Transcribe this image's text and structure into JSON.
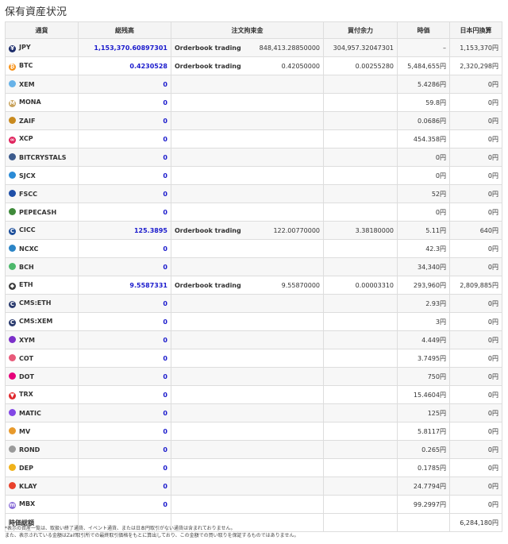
{
  "title": "保有資産状況",
  "headers": [
    "通貨",
    "総残高",
    "注文拘束金",
    "買付余力",
    "時価",
    "日本円換算"
  ],
  "rows": [
    {
      "currency": "JPY",
      "icon": "yen-icon",
      "icon_color": "#1d2d6b",
      "glyph": "¥",
      "balance": "1,153,370.60897301",
      "order_type": "Orderbook trading",
      "order_amount": "848,413.28850000",
      "buying_power": "304,957.32047301",
      "price": "–",
      "jpy_value": "1,153,370円"
    },
    {
      "currency": "BTC",
      "icon": "btc-icon",
      "icon_color": "#f7931a",
      "glyph": "₿",
      "balance": "0.4230528",
      "order_type": "Orderbook trading",
      "order_amount": "0.42050000",
      "buying_power": "0.00255280",
      "price": "5,484,655円",
      "jpy_value": "2,320,298円"
    },
    {
      "currency": "XEM",
      "icon": "xem-icon",
      "icon_color": "#67b2e8",
      "glyph": "",
      "balance": "0",
      "order_type": "",
      "order_amount": "",
      "buying_power": "",
      "price": "5.4286円",
      "jpy_value": "0円"
    },
    {
      "currency": "MONA",
      "icon": "mona-icon",
      "icon_color": "#c8a25b",
      "glyph": "M",
      "balance": "0",
      "order_type": "",
      "order_amount": "",
      "buying_power": "",
      "price": "59.8円",
      "jpy_value": "0円"
    },
    {
      "currency": "ZAIF",
      "icon": "zaif-icon",
      "icon_color": "#c98a1e",
      "glyph": "",
      "balance": "0",
      "order_type": "",
      "order_amount": "",
      "buying_power": "",
      "price": "0.0686円",
      "jpy_value": "0円"
    },
    {
      "currency": "XCP",
      "icon": "xcp-icon",
      "icon_color": "#e0245e",
      "glyph": "∞",
      "balance": "0",
      "order_type": "",
      "order_amount": "",
      "buying_power": "",
      "price": "454.358円",
      "jpy_value": "0円"
    },
    {
      "currency": "BITCRYSTALS",
      "icon": "bitcrystals-icon",
      "icon_color": "#3b5a8c",
      "glyph": "",
      "balance": "0",
      "order_type": "",
      "order_amount": "",
      "buying_power": "",
      "price": "0円",
      "jpy_value": "0円"
    },
    {
      "currency": "SJCX",
      "icon": "sjcx-icon",
      "icon_color": "#2a8bd6",
      "glyph": "",
      "balance": "0",
      "order_type": "",
      "order_amount": "",
      "buying_power": "",
      "price": "0円",
      "jpy_value": "0円"
    },
    {
      "currency": "FSCC",
      "icon": "fscc-icon",
      "icon_color": "#1f4fa8",
      "glyph": "",
      "balance": "0",
      "order_type": "",
      "order_amount": "",
      "buying_power": "",
      "price": "52円",
      "jpy_value": "0円"
    },
    {
      "currency": "PEPECASH",
      "icon": "pepecash-icon",
      "icon_color": "#3f8a3a",
      "glyph": "",
      "balance": "0",
      "order_type": "",
      "order_amount": "",
      "buying_power": "",
      "price": "0円",
      "jpy_value": "0円"
    },
    {
      "currency": "CICC",
      "icon": "cicc-icon",
      "icon_color": "#1c4e9a",
      "glyph": "C",
      "balance": "125.3895",
      "order_type": "Orderbook trading",
      "order_amount": "122.00770000",
      "buying_power": "3.38180000",
      "price": "5.11円",
      "jpy_value": "640円"
    },
    {
      "currency": "NCXC",
      "icon": "ncxc-icon",
      "icon_color": "#2b84c6",
      "glyph": "",
      "balance": "0",
      "order_type": "",
      "order_amount": "",
      "buying_power": "",
      "price": "42.3円",
      "jpy_value": "0円"
    },
    {
      "currency": "BCH",
      "icon": "bch-icon",
      "icon_color": "#4cb86b",
      "glyph": "",
      "balance": "0",
      "order_type": "",
      "order_amount": "",
      "buying_power": "",
      "price": "34,340円",
      "jpy_value": "0円"
    },
    {
      "currency": "ETH",
      "icon": "eth-icon",
      "icon_color": "#3c3c3d",
      "glyph": "◆",
      "balance": "9.5587331",
      "order_type": "Orderbook trading",
      "order_amount": "9.55870000",
      "buying_power": "0.00003310",
      "price": "293,960円",
      "jpy_value": "2,809,885円"
    },
    {
      "currency": "CMS:ETH",
      "icon": "cms-eth-icon",
      "icon_color": "#2a3b6e",
      "glyph": "C",
      "balance": "0",
      "order_type": "",
      "order_amount": "",
      "buying_power": "",
      "price": "2.93円",
      "jpy_value": "0円"
    },
    {
      "currency": "CMS:XEM",
      "icon": "cms-xem-icon",
      "icon_color": "#2a3b6e",
      "glyph": "C",
      "balance": "0",
      "order_type": "",
      "order_amount": "",
      "buying_power": "",
      "price": "3円",
      "jpy_value": "0円"
    },
    {
      "currency": "XYM",
      "icon": "xym-icon",
      "icon_color": "#7b2fc9",
      "glyph": "",
      "balance": "0",
      "order_type": "",
      "order_amount": "",
      "buying_power": "",
      "price": "4.449円",
      "jpy_value": "0円"
    },
    {
      "currency": "COT",
      "icon": "cot-icon",
      "icon_color": "#e85a7a",
      "glyph": "",
      "balance": "0",
      "order_type": "",
      "order_amount": "",
      "buying_power": "",
      "price": "3.7495円",
      "jpy_value": "0円"
    },
    {
      "currency": "DOT",
      "icon": "dot-icon",
      "icon_color": "#e6007a",
      "glyph": "",
      "balance": "0",
      "order_type": "",
      "order_amount": "",
      "buying_power": "",
      "price": "750円",
      "jpy_value": "0円"
    },
    {
      "currency": "TRX",
      "icon": "trx-icon",
      "icon_color": "#e0272c",
      "glyph": "▼",
      "balance": "0",
      "order_type": "",
      "order_amount": "",
      "buying_power": "",
      "price": "15.4604円",
      "jpy_value": "0円"
    },
    {
      "currency": "MATIC",
      "icon": "matic-icon",
      "icon_color": "#8247e5",
      "glyph": "",
      "balance": "0",
      "order_type": "",
      "order_amount": "",
      "buying_power": "",
      "price": "125円",
      "jpy_value": "0円"
    },
    {
      "currency": "MV",
      "icon": "mv-icon",
      "icon_color": "#e89a2c",
      "glyph": "",
      "balance": "0",
      "order_type": "",
      "order_amount": "",
      "buying_power": "",
      "price": "5.8117円",
      "jpy_value": "0円"
    },
    {
      "currency": "ROND",
      "icon": "rond-icon",
      "icon_color": "#9a9a9a",
      "glyph": "",
      "balance": "0",
      "order_type": "",
      "order_amount": "",
      "buying_power": "",
      "price": "0.265円",
      "jpy_value": "0円"
    },
    {
      "currency": "DEP",
      "icon": "dep-icon",
      "icon_color": "#f0b21a",
      "glyph": "",
      "balance": "0",
      "order_type": "",
      "order_amount": "",
      "buying_power": "",
      "price": "0.1785円",
      "jpy_value": "0円"
    },
    {
      "currency": "KLAY",
      "icon": "klay-icon",
      "icon_color": "#e8412c",
      "glyph": "",
      "balance": "0",
      "order_type": "",
      "order_amount": "",
      "buying_power": "",
      "price": "24.7794円",
      "jpy_value": "0円"
    },
    {
      "currency": "MBX",
      "icon": "mbx-icon",
      "icon_color": "#8a6fd8",
      "glyph": "m",
      "balance": "0",
      "order_type": "",
      "order_amount": "",
      "buying_power": "",
      "price": "99.2997円",
      "jpy_value": "0円"
    }
  ],
  "total": {
    "label": "時価総額",
    "value": "6,284,180円"
  },
  "notes": [
    "*表示の資産一覧は、取扱い終了通貨、イベント通貨、または日本円取引がない通貨は含まれておりません。",
    "また、表示されている金額はZaif取引所での最終取引価格をもとに算出しており、この金額での買い取りを保証するものではありません。"
  ]
}
